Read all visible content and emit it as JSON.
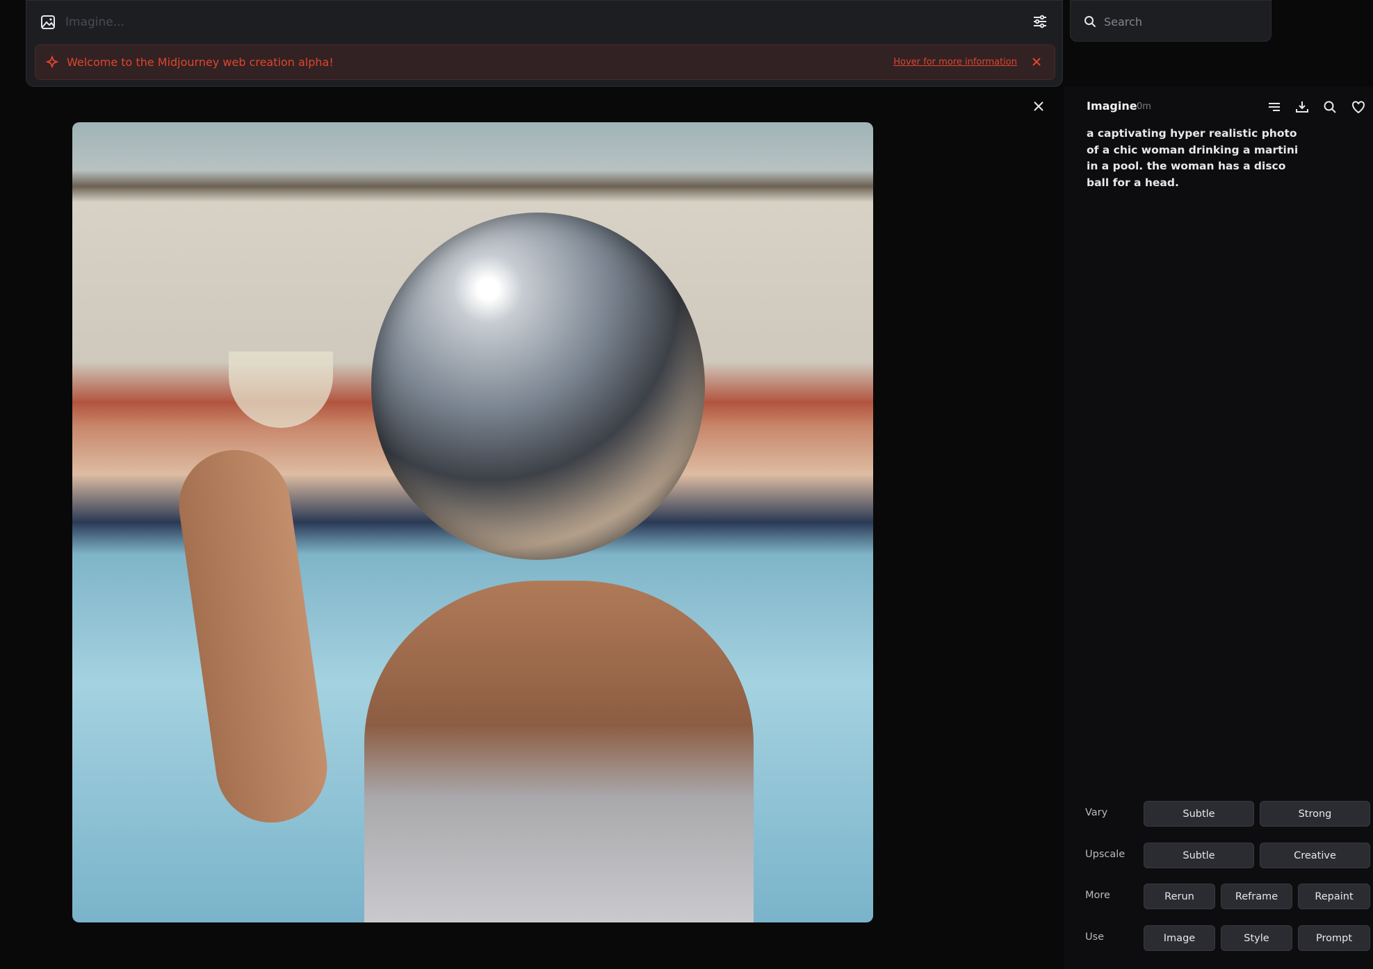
{
  "prompt_bar": {
    "placeholder": "Imagine...",
    "image_icon": "image-icon",
    "settings_icon": "sliders-icon"
  },
  "banner": {
    "message": "Welcome to the Midjourney web creation alpha!",
    "link": "Hover for more information",
    "color": "#e0452f"
  },
  "search": {
    "placeholder": "Search"
  },
  "detail": {
    "title": "Imagine",
    "time": "0m",
    "prompt": "a captivating hyper realistic photo of a chic woman drinking a martini in a pool. the woman has a disco ball for a head.",
    "icons": [
      "list-icon",
      "download-icon",
      "search-icon",
      "heart-icon"
    ],
    "rows": [
      {
        "label": "Vary",
        "buttons": [
          "Subtle",
          "Strong"
        ]
      },
      {
        "label": "Upscale",
        "buttons": [
          "Subtle",
          "Creative"
        ]
      },
      {
        "label": "More",
        "buttons": [
          "Rerun",
          "Reframe",
          "Repaint"
        ]
      },
      {
        "label": "Use",
        "buttons": [
          "Image",
          "Style",
          "Prompt"
        ]
      }
    ]
  }
}
